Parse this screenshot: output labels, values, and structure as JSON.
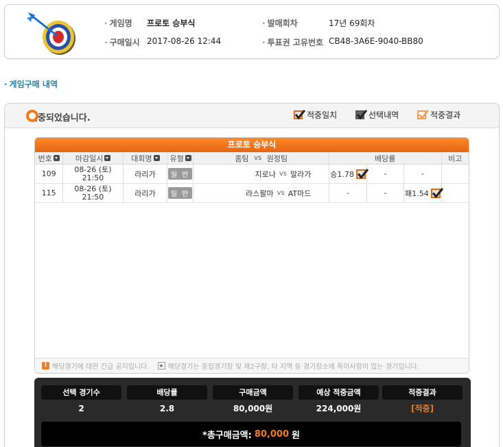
{
  "game_info": {
    "game_name_label": "게임명",
    "game_name_value": "프로토 승부식",
    "round_label": "발매회차",
    "round_value": "17년 69회차",
    "purchase_date_label": "구매일시",
    "purchase_date_value": "2017-08-26 12:44",
    "ticket_id_label": "투표권 고유번호",
    "ticket_id_value": "CB48-3A6E-9040-BB80"
  },
  "section_title": "게임구매 내역",
  "status": {
    "result_text": "적중되었습니다.",
    "legend": [
      {
        "label": "적중일치",
        "style": "orange"
      },
      {
        "label": "선택내역",
        "style": "gray"
      },
      {
        "label": "적중결과",
        "style": "hollow"
      }
    ]
  },
  "table": {
    "title": "프로토 승부식",
    "headers": {
      "no": "번호",
      "deadline": "마감일시",
      "league": "대회명",
      "type": "유형",
      "match_home": "홈팀",
      "match_vs": "vs",
      "match_away": "원정팀",
      "odds": "배당률",
      "note": "비고"
    },
    "rows": [
      {
        "no": "109",
        "date": "08-26 (토)",
        "time": "21:50",
        "league": "라리가",
        "type": "일 반",
        "home": "지로나",
        "vs": "vs",
        "away": "말라가",
        "odd1": "승1.78",
        "odd2": "-",
        "odd3": "-",
        "note": ""
      },
      {
        "no": "115",
        "date": "08-26 (토)",
        "time": "21:50",
        "league": "라리가",
        "type": "일 반",
        "home": "라스팔마",
        "vs": "vs",
        "away": "AT마드",
        "odd1": "-",
        "odd2": "-",
        "odd3": "패1.54",
        "note": ""
      }
    ],
    "notice_urgent": "해당경기에 대한 긴급 공지입니다.",
    "notice_neutral": "해당경기는 중립경기장 및 제2구장, 타 지역 등 경기장소에 특이사항이 있는 경기입니다."
  },
  "summary": {
    "headers": [
      "선택 경기수",
      "배당률",
      "구매금액",
      "예상 적중금액",
      "적중결과"
    ],
    "values": [
      "2",
      "2.8",
      "80,000원",
      "224,000원",
      "[적중]"
    ],
    "total_label": "*총구매금액:",
    "total_amount": "80,000",
    "total_unit": "원"
  },
  "colors": {
    "accent_orange": "#f07a1f",
    "title_blue": "#2b7fa3",
    "summary_bg": "#2a2a2a"
  }
}
